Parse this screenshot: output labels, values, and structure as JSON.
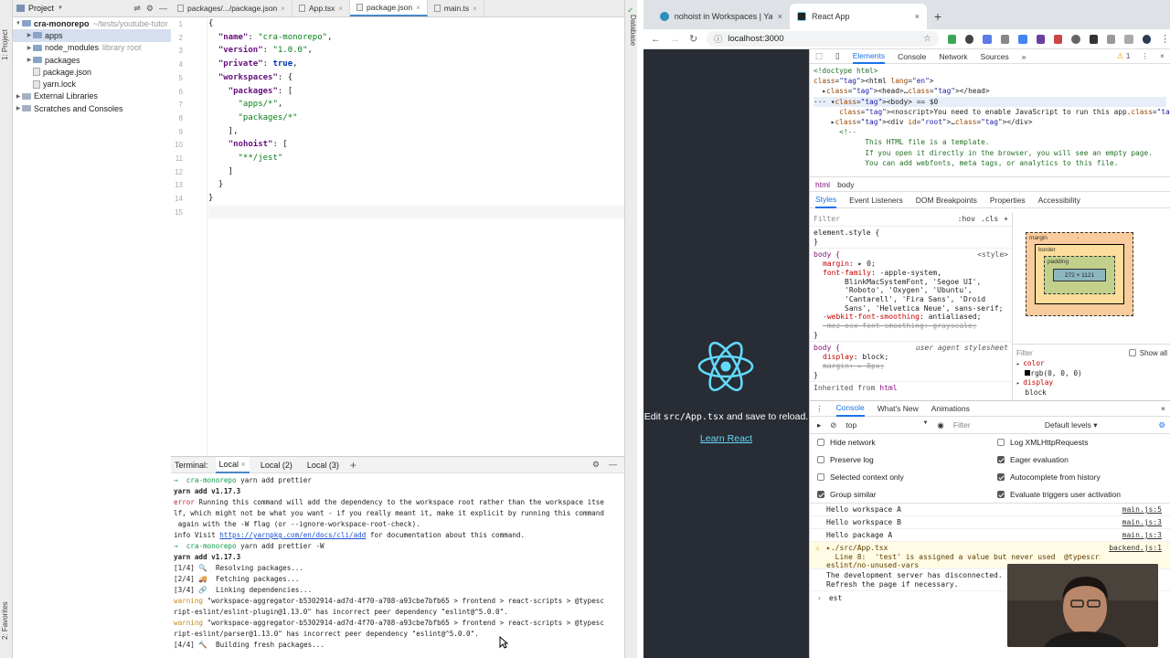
{
  "ide": {
    "sidebar_tabs": [
      "1: Project",
      "2: Favorites"
    ],
    "right_tabs": [
      "Database"
    ],
    "project_header": "Project",
    "tree": [
      {
        "label": "cra-monorepo",
        "note": "~/tests/youtube-tutor",
        "bold": true,
        "expanded": true,
        "type": "folder"
      },
      {
        "label": "apps",
        "note": "",
        "selected": true,
        "type": "folder"
      },
      {
        "label": "node_modules",
        "note": "library root",
        "type": "folder"
      },
      {
        "label": "packages",
        "note": "",
        "type": "folder"
      },
      {
        "label": "package.json",
        "note": "",
        "type": "file"
      },
      {
        "label": "yarn.lock",
        "note": "",
        "type": "file"
      },
      {
        "label": "External Libraries",
        "note": "",
        "type": "lib"
      },
      {
        "label": "Scratches and Consoles",
        "note": "",
        "type": "lib"
      }
    ],
    "tabs": [
      {
        "label": "packages/.../package.json",
        "active": false
      },
      {
        "label": "App.tsx",
        "active": false
      },
      {
        "label": "package.json",
        "active": true
      },
      {
        "label": "main.ts",
        "active": false
      }
    ],
    "line_numbers": [
      "1",
      "2",
      "3",
      "4",
      "5",
      "6",
      "7",
      "8",
      "9",
      "10",
      "11",
      "12",
      "13",
      "14",
      "15"
    ],
    "code": [
      "{",
      "  \"name\": \"cra-monorepo\",",
      "  \"version\": \"1.0.0\",",
      "  \"private\": true,",
      "  \"workspaces\": {",
      "    \"packages\": [",
      "      \"apps/*\",",
      "      \"packages/*\"",
      "    ],",
      "    \"nohoist\": [",
      "      \"**/jest\"",
      "    ]",
      "  }",
      "}",
      ""
    ],
    "terminal": {
      "title": "Terminal:",
      "tabs": [
        "Local",
        "Local (2)",
        "Local (3)"
      ],
      "plus": "+",
      "lines": [
        {
          "t": "prompt",
          "text": "→  cra-monorepo yarn add prettier"
        },
        {
          "t": "bold",
          "text": "yarn add v1.17.3"
        },
        {
          "t": "err",
          "text": "error Running this command will add the dependency to the workspace root rather than the workspace itse"
        },
        {
          "t": "plain",
          "text": "lf, which might not be what you want - if you really meant it, make it explicit by running this command"
        },
        {
          "t": "plain",
          "text": " again with the -W flag (or --ignore-workspace-root-check)."
        },
        {
          "t": "info",
          "text": "info Visit https://yarnpkg.com/en/docs/cli/add for documentation about this command."
        },
        {
          "t": "prompt",
          "text": "→  cra-monorepo yarn add prettier -W"
        },
        {
          "t": "bold",
          "text": "yarn add v1.17.3"
        },
        {
          "t": "plain",
          "text": "[1/4] 🔍  Resolving packages..."
        },
        {
          "t": "plain",
          "text": "[2/4] 🚚  Fetching packages..."
        },
        {
          "t": "plain",
          "text": "[3/4] 🔗  Linking dependencies..."
        },
        {
          "t": "warn",
          "text": "warning \"workspace-aggregator-b5302914-ad7d-4f70-a708-a93cbe7bfb65 > frontend > react-scripts > @typesc"
        },
        {
          "t": "plain",
          "text": "ript-eslint/eslint-plugin@1.13.0\" has incorrect peer dependency \"eslint@^5.0.0\"."
        },
        {
          "t": "warn",
          "text": "warning \"workspace-aggregator-b5302914-ad7d-4f70-a708-a93cbe7bfb65 > frontend > react-scripts > @typesc"
        },
        {
          "t": "plain",
          "text": "ript-eslint/parser@1.13.0\" has incorrect peer dependency \"eslint@^5.0.0\"."
        },
        {
          "t": "plain",
          "text": "[4/4] 🔨  Building fresh packages..."
        }
      ]
    }
  },
  "browser": {
    "tabs": [
      {
        "title": "nohoist in Workspaces | Yarn B",
        "active": false
      },
      {
        "title": "React App",
        "active": true
      }
    ],
    "url": "localhost:3000",
    "page": {
      "edit_prefix": "Edit ",
      "edit_code": "src/App.tsx",
      "edit_suffix": " and save to reload.",
      "learn": "Learn React"
    },
    "devtools": {
      "tabs": [
        "Elements",
        "Console",
        "Network",
        "Sources",
        "»"
      ],
      "warning_count": "1",
      "dom": [
        {
          "cls": "cm",
          "text": "<!doctype html>"
        },
        {
          "cls": "",
          "text": "<html lang=\"en\">"
        },
        {
          "cls": "",
          "text": "  ▸<head>…</head>"
        },
        {
          "cls": "domsel",
          "text": "··· ▾<body> == $0"
        },
        {
          "cls": "",
          "text": "      <noscript>You need to enable JavaScript to run this app.</noscript>"
        },
        {
          "cls": "",
          "text": "    ▸<div id=\"root\">…</div>"
        },
        {
          "cls": "cm",
          "text": "      <!--"
        },
        {
          "cls": "cm",
          "text": "            This HTML file is a template."
        },
        {
          "cls": "cm",
          "text": "            If you open it directly in the browser, you will see an empty page."
        },
        {
          "cls": "cm",
          "text": ""
        },
        {
          "cls": "cm",
          "text": "            You can add webfonts, meta tags, or analytics to this file."
        }
      ],
      "crumbs": [
        "html",
        "body"
      ],
      "style_tabs": [
        "Styles",
        "Event Listeners",
        "DOM Breakpoints",
        "Properties",
        "Accessibility"
      ],
      "filter": "Filter",
      "hov": ":hov",
      "cls": ".cls",
      "element_style": "element.style {",
      "close_brace": "}",
      "body_rule": {
        "selector": "body {",
        "source": "<style>",
        "lines": [
          {
            "p": "margin",
            "v": "▸ 0;",
            "strike": false
          },
          {
            "p": "font-family",
            "v": "-apple-system,",
            "strike": false
          },
          {
            "p": "",
            "v": "BlinkMacSystemFont, 'Segoe UI',",
            "strike": false
          },
          {
            "p": "",
            "v": "'Roboto', 'Oxygen', 'Ubuntu',",
            "strike": false
          },
          {
            "p": "",
            "v": "'Cantarell', 'Fira Sans', 'Droid",
            "strike": false
          },
          {
            "p": "",
            "v": "Sans', 'Helvetica Neue', sans-serif;",
            "strike": false
          },
          {
            "p": "-webkit-font-smoothing",
            "v": "antialiased;",
            "strike": false
          },
          {
            "p": "-moz-osx-font-smoothing",
            "v": "grayscale;",
            "strike": true
          }
        ]
      },
      "ua_rule": {
        "selector": "body {",
        "source": "user agent stylesheet",
        "lines": [
          {
            "p": "display",
            "v": "block;",
            "strike": false
          },
          {
            "p": "margin",
            "v": "▸ 8px;",
            "strike": true
          }
        ]
      },
      "inherited": "Inherited from",
      "inherited_tag": "html",
      "boxmodel": {
        "margin": "margin",
        "border": "border",
        "padding": "padding",
        "content": "272 × 1121",
        "dash": "-"
      },
      "computed": {
        "filter": "Filter",
        "show_all": "Show all",
        "props": [
          {
            "p": "color",
            "v": "rgb(0, 0, 0)"
          },
          {
            "p": "display",
            "v": "block"
          }
        ]
      },
      "drawer": {
        "tabs": [
          "Console",
          "What's New",
          "Animations"
        ],
        "context": "top",
        "filter": "Filter",
        "levels": "Default levels ▾",
        "settings_left": [
          {
            "label": "Hide network",
            "on": false
          },
          {
            "label": "Preserve log",
            "on": false
          },
          {
            "label": "Selected context only",
            "on": false
          },
          {
            "label": "Group similar",
            "on": true
          }
        ],
        "settings_right": [
          {
            "label": "Log XMLHttpRequests",
            "on": false
          },
          {
            "label": "Eager evaluation",
            "on": true
          },
          {
            "label": "Autocomplete from history",
            "on": true
          },
          {
            "label": "Evaluate triggers user activation",
            "on": true
          }
        ],
        "logs": [
          {
            "msg": "Hello workspace A",
            "src": "main.js:5",
            "type": "log"
          },
          {
            "msg": "Hello workspace B",
            "src": "main.js:3",
            "type": "log"
          },
          {
            "msg": "Hello package A",
            "src": "main.js:3",
            "type": "log"
          },
          {
            "msg": "▸./src/App.tsx\n  Line 8:  'test' is assigned a value but never used  @typescript-\neslint/no-unused-vars",
            "src": "backend.js:1",
            "type": "warn"
          },
          {
            "msg": "The development server has disconnected.\nRefresh the page if necessary.",
            "src": "",
            "type": "log2"
          }
        ],
        "input": "est"
      }
    }
  },
  "colors": {
    "accent": "#1a73e8",
    "react_bg": "#282c34",
    "react_cyan": "#61dafb",
    "prompt_green": "#0a9a48",
    "error_red": "#c4282a"
  }
}
